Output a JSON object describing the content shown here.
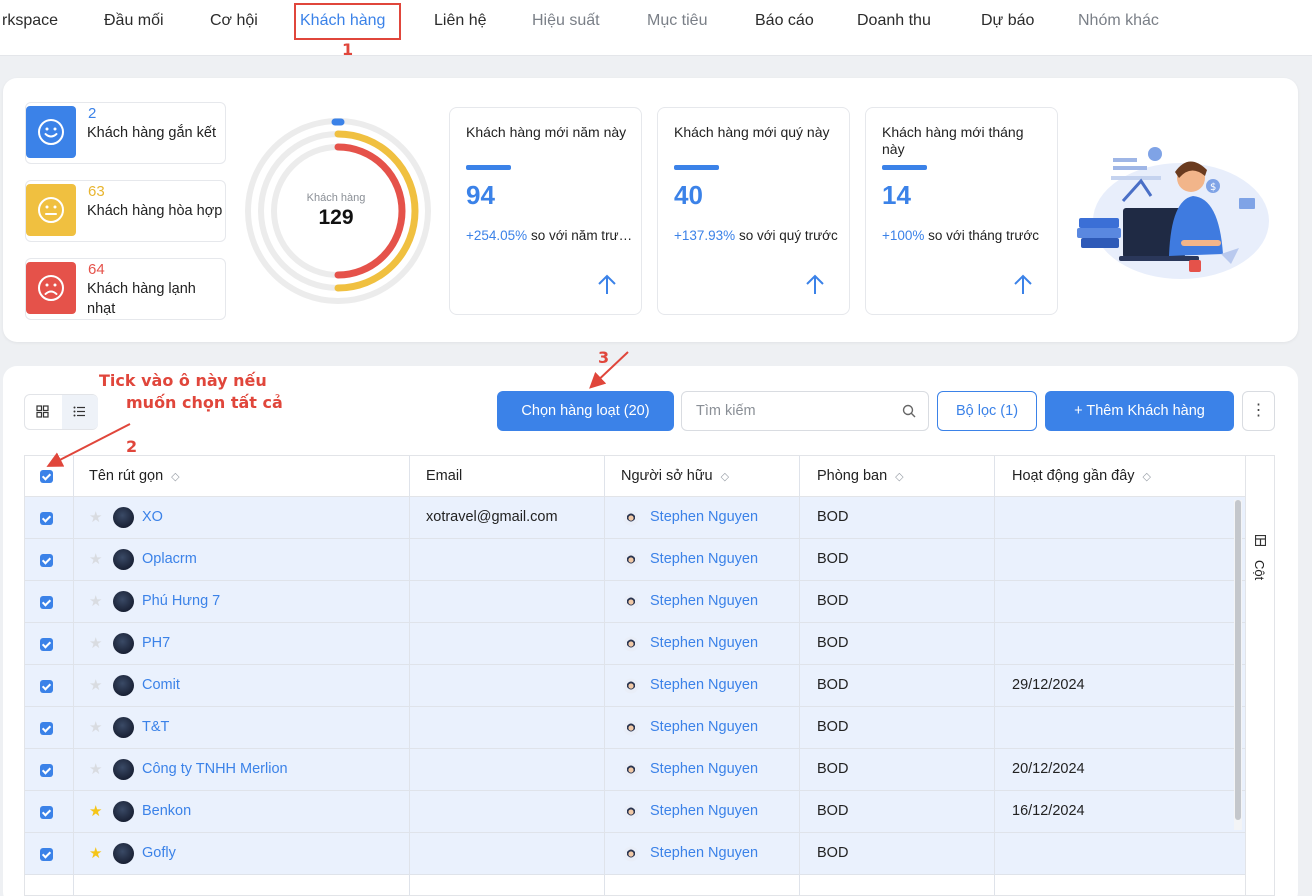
{
  "nav": {
    "items": [
      {
        "label": "rkspace",
        "style": "normal"
      },
      {
        "label": "Đầu mối",
        "style": "normal"
      },
      {
        "label": "Cơ hội",
        "style": "normal"
      },
      {
        "label": "Khách hàng",
        "style": "active"
      },
      {
        "label": "Liên hệ",
        "style": "normal"
      },
      {
        "label": "Hiệu suất",
        "style": "muted"
      },
      {
        "label": "Mục tiêu",
        "style": "muted"
      },
      {
        "label": "Báo cáo",
        "style": "normal"
      },
      {
        "label": "Doanh thu",
        "style": "normal"
      },
      {
        "label": "Dự báo",
        "style": "normal"
      },
      {
        "label": "Nhóm khác",
        "style": "muted"
      }
    ]
  },
  "annotations": {
    "n1": "1",
    "n2": "2",
    "n3": "3",
    "tip_line1": "Tick vào ô này nếu",
    "tip_line2": "muốn chọn tất cả",
    "color": "#e0463b"
  },
  "segments": [
    {
      "count": "2",
      "label": "Khách hàng gắn kết",
      "color": "#3b82e8",
      "icon": "smile-icon"
    },
    {
      "count": "63",
      "label": "Khách hàng hòa hợp",
      "color": "#f0c040",
      "icon": "neutral-face-icon"
    },
    {
      "count": "64",
      "label": "Khách hàng lạnh nhạt",
      "color": "#e5524a",
      "icon": "sad-face-icon"
    }
  ],
  "donut": {
    "caption": "Khách hàng",
    "total": "129"
  },
  "kpis": [
    {
      "title": "Khách hàng mới năm này",
      "value": "94",
      "pct": "+254.05%",
      "suffix": " so với năm trước"
    },
    {
      "title": "Khách hàng mới quý này",
      "value": "40",
      "pct": "+137.93%",
      "suffix": " so với quý trước"
    },
    {
      "title": "Khách hàng mới tháng này",
      "value": "14",
      "pct": "+100%",
      "suffix": " so với tháng trước"
    }
  ],
  "toolbar": {
    "bulk_label": "Chọn hàng loạt (20)",
    "search_placeholder": "Tìm kiếm",
    "filter_label": "Bộ lọc (1)",
    "add_label": "+  Thêm Khách hàng",
    "more_label": "⋮"
  },
  "table": {
    "headers": {
      "short_name": "Tên rút gọn",
      "email": "Email",
      "owner": "Người sở hữu",
      "dept": "Phòng ban",
      "activity": "Hoạt động gần đây"
    },
    "sort_glyph": "◇",
    "columns_label": "Cột",
    "rows": [
      {
        "name": "XO",
        "starred": false,
        "email": "xotravel@gmail.com",
        "owner": "Stephen Nguyen",
        "dept": "BOD",
        "activity": ""
      },
      {
        "name": "Oplacrm",
        "starred": false,
        "email": "",
        "owner": "Stephen Nguyen",
        "dept": "BOD",
        "activity": ""
      },
      {
        "name": "Phú Hưng 7",
        "starred": false,
        "email": "",
        "owner": "Stephen Nguyen",
        "dept": "BOD",
        "activity": ""
      },
      {
        "name": "PH7",
        "starred": false,
        "email": "",
        "owner": "Stephen Nguyen",
        "dept": "BOD",
        "activity": ""
      },
      {
        "name": "Comit",
        "starred": false,
        "email": "",
        "owner": "Stephen Nguyen",
        "dept": "BOD",
        "activity": "29/12/2024"
      },
      {
        "name": "T&T",
        "starred": false,
        "email": "",
        "owner": "Stephen Nguyen",
        "dept": "BOD",
        "activity": ""
      },
      {
        "name": "Công ty TNHH Merlion",
        "starred": false,
        "email": "",
        "owner": "Stephen Nguyen",
        "dept": "BOD",
        "activity": "20/12/2024"
      },
      {
        "name": "Benkon",
        "starred": true,
        "email": "",
        "owner": "Stephen Nguyen",
        "dept": "BOD",
        "activity": "16/12/2024"
      },
      {
        "name": "Gofly",
        "starred": true,
        "email": "",
        "owner": "Stephen Nguyen",
        "dept": "BOD",
        "activity": ""
      }
    ]
  },
  "colors": {
    "accent": "#3b82e8",
    "row_selected": "#eaf1fd",
    "star_on": "#f5c518",
    "star_off": "#d9dce1"
  }
}
